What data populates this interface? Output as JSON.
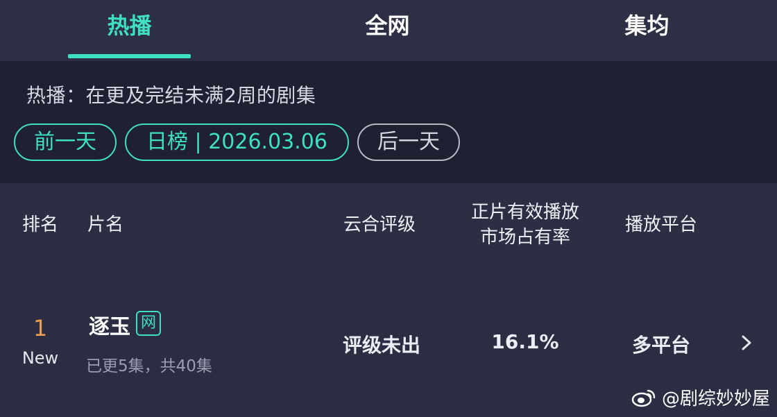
{
  "tabs": [
    {
      "label": "热播",
      "active": true
    },
    {
      "label": "全网",
      "active": false
    },
    {
      "label": "集均",
      "active": false
    }
  ],
  "description": "热播：在更及完结未满2周的剧集",
  "date_nav": {
    "prev_label": "前一天",
    "current_label": "日榜 | 2026.03.06",
    "next_label": "后一天"
  },
  "columns": {
    "rank": "排名",
    "title": "片名",
    "rating": "云合评级",
    "share_line1": "正片有效播放",
    "share_line2": "市场占有率",
    "platform": "播放平台"
  },
  "rows": [
    {
      "rank": "1",
      "status": "New",
      "title": "逐玉",
      "badge": "网",
      "episodes": "已更5集，共40集",
      "rating": "评级未出",
      "share": "16.1%",
      "platform": "多平台"
    }
  ],
  "footer": {
    "text": "@剧综妙妙屋",
    "icon": "weibo-icon"
  },
  "colors": {
    "accent": "#3ee0c0",
    "rank": "#e9a052",
    "background": "#2b2d42"
  }
}
